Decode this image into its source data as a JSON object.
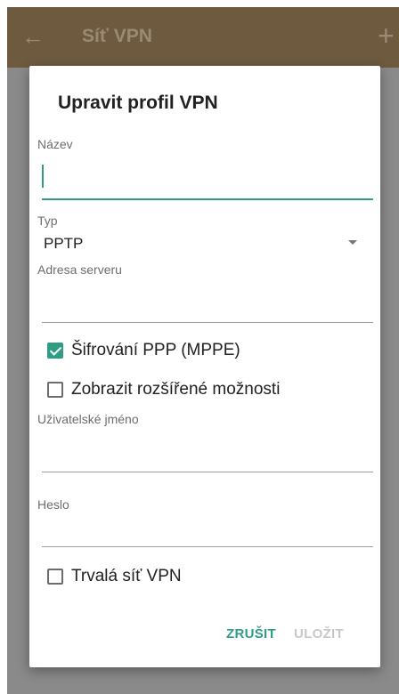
{
  "appbar": {
    "title": "Síť VPN",
    "back_icon": "arrow-left-icon",
    "add_icon": "plus-icon"
  },
  "dialog": {
    "title": "Upravit profil VPN",
    "name": {
      "label": "Název",
      "value": ""
    },
    "type": {
      "label": "Typ",
      "value": "PPTP"
    },
    "server": {
      "label": "Adresa serveru",
      "value": ""
    },
    "encryption": {
      "label": "Šifrování PPP (MPPE)",
      "checked": true
    },
    "advanced": {
      "label": "Zobrazit rozšířené možnosti",
      "checked": false
    },
    "username": {
      "label": "Uživatelské jméno",
      "value": ""
    },
    "password": {
      "label": "Heslo",
      "value": ""
    },
    "always_on": {
      "label": "Trvalá síť VPN",
      "checked": false
    },
    "buttons": {
      "cancel": "ZRUŠIT",
      "save": "ULOŽIT"
    }
  },
  "colors": {
    "accent": "#2e9d84",
    "appbar": "#6e5a3f",
    "scrim": "#8a8a8a"
  }
}
